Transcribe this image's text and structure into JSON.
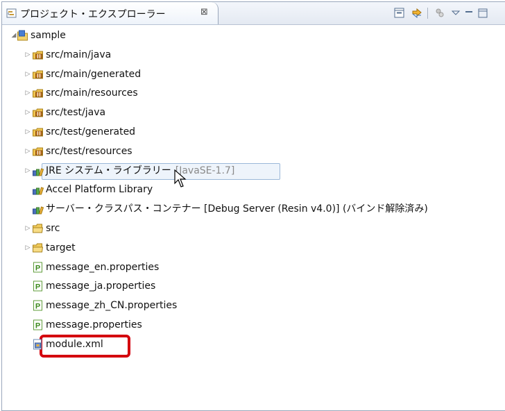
{
  "view": {
    "title": "プロジェクト・エクスプローラー",
    "close_glyph": "⊠"
  },
  "tree": {
    "project": {
      "label": "sample",
      "icon": "project-icon",
      "twisty": "◢"
    },
    "items": [
      {
        "label": "src/main/java",
        "icon": "source-package-icon",
        "twisty": "▷"
      },
      {
        "label": "src/main/generated",
        "icon": "source-package-icon",
        "twisty": "▷"
      },
      {
        "label": "src/main/resources",
        "icon": "source-package-icon",
        "twisty": "▷"
      },
      {
        "label": "src/test/java",
        "icon": "source-package-icon",
        "twisty": "▷"
      },
      {
        "label": "src/test/generated",
        "icon": "source-package-icon",
        "twisty": "▷"
      },
      {
        "label": "src/test/resources",
        "icon": "source-package-icon",
        "twisty": "▷"
      },
      {
        "label": "JRE システム・ライブラリー",
        "decoration": "[JavaSE-1.7]",
        "icon": "library-icon",
        "twisty": "▷"
      },
      {
        "label": "Accel Platform Library",
        "icon": "library-icon",
        "twisty": ""
      },
      {
        "label": "サーバー・クラスパス・コンテナー [Debug Server (Resin v4.0)] (バインド解除済み)",
        "icon": "library-icon",
        "twisty": ""
      },
      {
        "label": "src",
        "icon": "folder-icon",
        "twisty": "▷"
      },
      {
        "label": "target",
        "icon": "folder-icon",
        "twisty": "▷"
      },
      {
        "label": "message_en.properties",
        "icon": "properties-file-icon",
        "twisty": ""
      },
      {
        "label": "message_ja.properties",
        "icon": "properties-file-icon",
        "twisty": ""
      },
      {
        "label": "message_zh_CN.properties",
        "icon": "properties-file-icon",
        "twisty": ""
      },
      {
        "label": "message.properties",
        "icon": "properties-file-icon",
        "twisty": ""
      },
      {
        "label": "module.xml",
        "icon": "xml-file-icon",
        "twisty": ""
      }
    ]
  },
  "colors": {
    "highlight": "#d4000e",
    "hover_border": "#9bb8d9",
    "hover_bg": "#eef4fb"
  }
}
